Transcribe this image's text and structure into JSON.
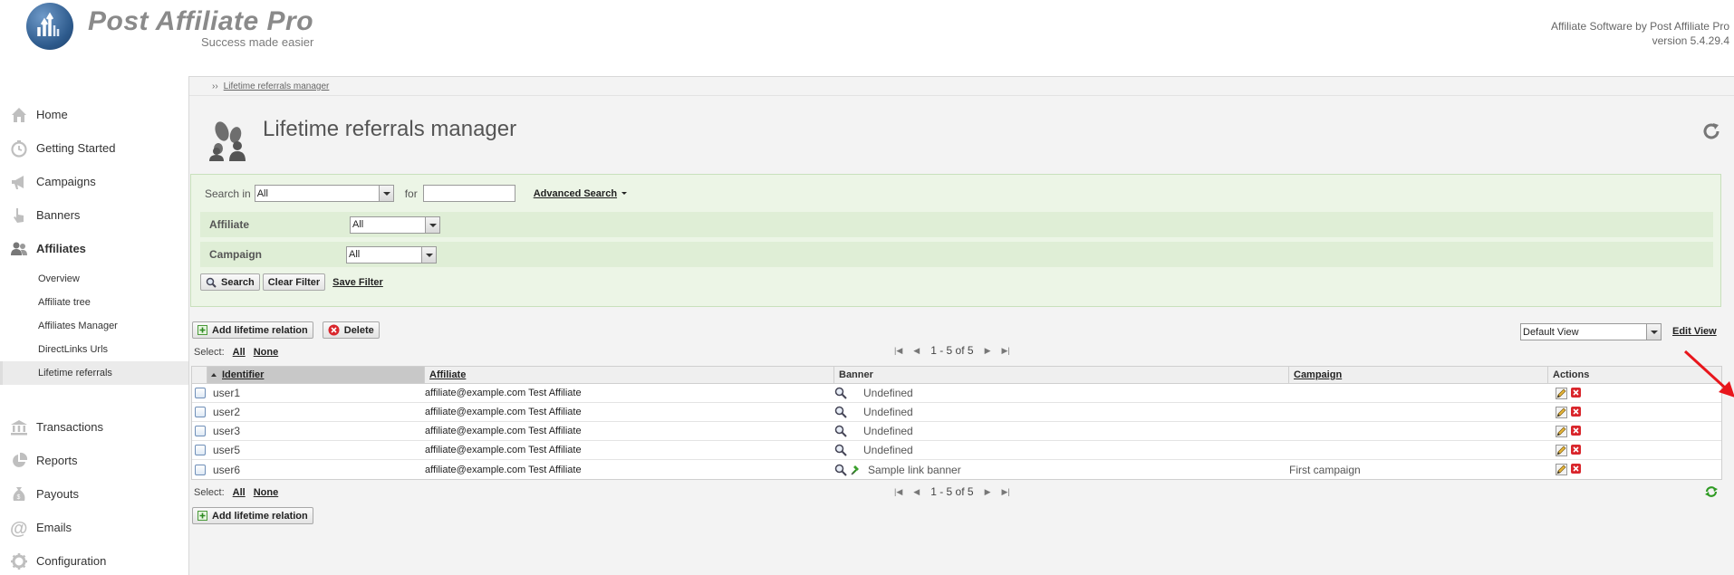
{
  "header": {
    "brand_name": "Post Affiliate Pro",
    "brand_tagline": "Success made easier",
    "right_line1": "Affiliate Software by Post Affiliate Pro",
    "right_line2": "version 5.4.29.4"
  },
  "sidebar": {
    "items": [
      {
        "label": "Home",
        "icon": "home-icon"
      },
      {
        "label": "Getting Started",
        "icon": "stopwatch-icon"
      },
      {
        "label": "Campaigns",
        "icon": "megaphone-icon"
      },
      {
        "label": "Banners",
        "icon": "hand-pointer-icon"
      },
      {
        "label": "Affiliates",
        "icon": "users-icon"
      },
      {
        "label": "Transactions",
        "icon": "bank-icon"
      },
      {
        "label": "Reports",
        "icon": "pie-chart-icon"
      },
      {
        "label": "Payouts",
        "icon": "money-bag-icon"
      },
      {
        "label": "Emails",
        "icon": "at-sign-icon"
      },
      {
        "label": "Configuration",
        "icon": "gear-icon"
      }
    ],
    "sub_items": [
      "Overview",
      "Affiliate tree",
      "Affiliates Manager",
      "DirectLinks Urls",
      "Lifetime referrals"
    ]
  },
  "breadcrumb": {
    "prefix": "››",
    "link": "Lifetime referrals manager"
  },
  "page": {
    "title": "Lifetime referrals manager",
    "icon": "footprints-users-icon"
  },
  "filter": {
    "search_in_label": "Search in",
    "search_in_value": "All",
    "for_label": "for",
    "search_text": "",
    "advanced_search": "Advanced Search",
    "affiliate_label": "Affiliate",
    "affiliate_value": "All",
    "campaign_label": "Campaign",
    "campaign_value": "All",
    "search_button": "Search",
    "clear_button": "Clear Filter",
    "save_button": "Save Filter"
  },
  "toolbar": {
    "add_button": "Add lifetime relation",
    "delete_button": "Delete"
  },
  "selection": {
    "label": "Select:",
    "all": "All",
    "none": "None"
  },
  "pager": {
    "text": "1 - 5 of 5"
  },
  "view": {
    "selected": "Default View",
    "edit_view": "Edit View"
  },
  "grid": {
    "columns": {
      "identifier": "Identifier",
      "affiliate": "Affiliate",
      "banner": "Banner",
      "campaign": "Campaign",
      "actions": "Actions"
    },
    "rows": [
      {
        "identifier": "user1",
        "affiliate": "affiliate@example.com Test Affiliate",
        "banner": "Undefined",
        "campaign": "",
        "banner_link": false
      },
      {
        "identifier": "user2",
        "affiliate": "affiliate@example.com Test Affiliate",
        "banner": "Undefined",
        "campaign": "",
        "banner_link": false
      },
      {
        "identifier": "user3",
        "affiliate": "affiliate@example.com Test Affiliate",
        "banner": "Undefined",
        "campaign": "",
        "banner_link": false
      },
      {
        "identifier": "user5",
        "affiliate": "affiliate@example.com Test Affiliate",
        "banner": "Undefined",
        "campaign": "",
        "banner_link": false
      },
      {
        "identifier": "user6",
        "affiliate": "affiliate@example.com Test Affiliate",
        "banner": "Sample link banner",
        "campaign": "First campaign",
        "banner_link": true
      }
    ]
  },
  "colors": {
    "filter_bg": "#ecf5e6",
    "filter_row": "#dfeed6",
    "annotation_arrow": "#e8161c",
    "brand_blue": "#2d5a8c"
  }
}
